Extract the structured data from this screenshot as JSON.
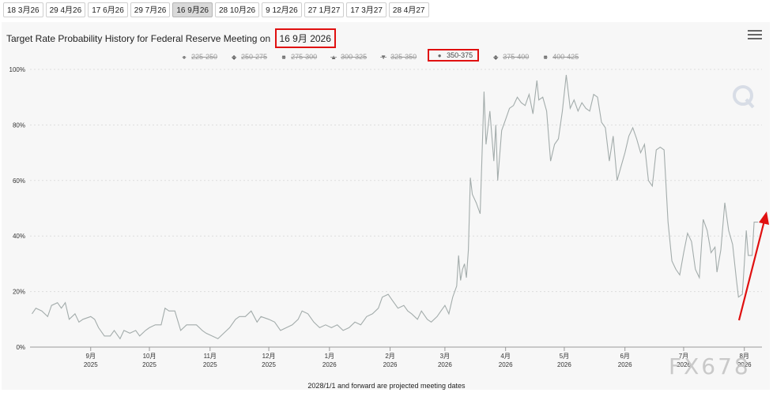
{
  "tabs": [
    {
      "label": "18 3月26",
      "active": false
    },
    {
      "label": "29 4月26",
      "active": false
    },
    {
      "label": "17 6月26",
      "active": false
    },
    {
      "label": "29 7月26",
      "active": false
    },
    {
      "label": "16 9月26",
      "active": true
    },
    {
      "label": "28 10月26",
      "active": false
    },
    {
      "label": "9 12月26",
      "active": false
    },
    {
      "label": "27 1月27",
      "active": false
    },
    {
      "label": "17 3月27",
      "active": false
    },
    {
      "label": "28 4月27",
      "active": false
    }
  ],
  "header": {
    "title_prefix": "Target Rate Probability History for Federal Reserve Meeting on",
    "title_date": "16 9月 2026",
    "menu_icon": "hamburger-menu-icon"
  },
  "footnote": "2028/1/1 and forward are projected meeting dates",
  "watermark": "FX678",
  "colors": {
    "series": "#a3acab",
    "annotation": "#e01010",
    "grid": "#dddddd",
    "panel": "#f7f7f7"
  },
  "chart_data": {
    "type": "line",
    "ylim": [
      0,
      100
    ],
    "y_ticks": [
      0,
      20,
      40,
      60,
      80,
      100
    ],
    "y_tick_labels": [
      "0%",
      "20%",
      "40%",
      "60%",
      "80%",
      "100%"
    ],
    "x_range": [
      "2025-08-01",
      "2026-08-10"
    ],
    "x_ticks": [
      {
        "date": "2025-09-01",
        "month": "9月",
        "year": "2025"
      },
      {
        "date": "2025-10-01",
        "month": "10月",
        "year": "2025"
      },
      {
        "date": "2025-11-01",
        "month": "11月",
        "year": "2025"
      },
      {
        "date": "2025-12-01",
        "month": "12月",
        "year": "2025"
      },
      {
        "date": "2026-01-01",
        "month": "1月",
        "year": "2026"
      },
      {
        "date": "2026-02-01",
        "month": "2月",
        "year": "2026"
      },
      {
        "date": "2026-03-01",
        "month": "3月",
        "year": "2026"
      },
      {
        "date": "2026-04-01",
        "month": "4月",
        "year": "2026"
      },
      {
        "date": "2026-05-01",
        "month": "5月",
        "year": "2026"
      },
      {
        "date": "2026-06-01",
        "month": "6月",
        "year": "2026"
      },
      {
        "date": "2026-07-01",
        "month": "7月",
        "year": "2026"
      },
      {
        "date": "2026-08-01",
        "month": "8月",
        "year": "2026"
      }
    ],
    "legend": [
      {
        "name": "225-250",
        "symbol": "●",
        "visible": false
      },
      {
        "name": "250-275",
        "symbol": "◆",
        "visible": false
      },
      {
        "name": "275-300",
        "symbol": "■",
        "visible": false
      },
      {
        "name": "300-325",
        "symbol": "▲",
        "visible": false
      },
      {
        "name": "325-350",
        "symbol": "▼",
        "visible": false
      },
      {
        "name": "350-375",
        "symbol": "●",
        "visible": true
      },
      {
        "name": "375-400",
        "symbol": "◆",
        "visible": false
      },
      {
        "name": "400-425",
        "symbol": "■",
        "visible": false
      }
    ],
    "series": [
      {
        "name": "350-375",
        "points": [
          [
            "2025-08-02",
            12
          ],
          [
            "2025-08-04",
            14
          ],
          [
            "2025-08-07",
            13
          ],
          [
            "2025-08-10",
            11
          ],
          [
            "2025-08-12",
            15
          ],
          [
            "2025-08-15",
            16
          ],
          [
            "2025-08-17",
            14
          ],
          [
            "2025-08-19",
            16
          ],
          [
            "2025-08-21",
            10
          ],
          [
            "2025-08-24",
            12
          ],
          [
            "2025-08-26",
            9
          ],
          [
            "2025-08-28",
            10
          ],
          [
            "2025-09-01",
            11
          ],
          [
            "2025-09-03",
            10
          ],
          [
            "2025-09-05",
            7
          ],
          [
            "2025-09-08",
            4
          ],
          [
            "2025-09-11",
            4
          ],
          [
            "2025-09-13",
            6
          ],
          [
            "2025-09-16",
            3
          ],
          [
            "2025-09-18",
            6
          ],
          [
            "2025-09-21",
            5
          ],
          [
            "2025-09-24",
            6
          ],
          [
            "2025-09-26",
            4
          ],
          [
            "2025-09-29",
            6
          ],
          [
            "2025-10-01",
            7
          ],
          [
            "2025-10-04",
            8
          ],
          [
            "2025-10-07",
            8
          ],
          [
            "2025-10-09",
            14
          ],
          [
            "2025-10-11",
            13
          ],
          [
            "2025-10-14",
            13
          ],
          [
            "2025-10-17",
            6
          ],
          [
            "2025-10-20",
            8
          ],
          [
            "2025-10-22",
            8
          ],
          [
            "2025-10-25",
            8
          ],
          [
            "2025-10-28",
            6
          ],
          [
            "2025-10-30",
            5
          ],
          [
            "2025-11-02",
            4
          ],
          [
            "2025-11-05",
            3
          ],
          [
            "2025-11-08",
            5
          ],
          [
            "2025-11-11",
            7
          ],
          [
            "2025-11-14",
            10
          ],
          [
            "2025-11-16",
            11
          ],
          [
            "2025-11-19",
            11
          ],
          [
            "2025-11-22",
            13
          ],
          [
            "2025-11-25",
            9
          ],
          [
            "2025-11-27",
            11
          ],
          [
            "2025-12-01",
            10
          ],
          [
            "2025-12-04",
            9
          ],
          [
            "2025-12-07",
            6
          ],
          [
            "2025-12-10",
            7
          ],
          [
            "2025-12-13",
            8
          ],
          [
            "2025-12-16",
            10
          ],
          [
            "2025-12-18",
            13
          ],
          [
            "2025-12-21",
            12
          ],
          [
            "2025-12-24",
            9
          ],
          [
            "2025-12-27",
            7
          ],
          [
            "2025-12-30",
            8
          ],
          [
            "2026-01-02",
            7
          ],
          [
            "2026-01-05",
            8
          ],
          [
            "2026-01-08",
            6
          ],
          [
            "2026-01-11",
            7
          ],
          [
            "2026-01-14",
            9
          ],
          [
            "2026-01-17",
            8
          ],
          [
            "2026-01-20",
            11
          ],
          [
            "2026-01-23",
            12
          ],
          [
            "2026-01-26",
            14
          ],
          [
            "2026-01-28",
            18
          ],
          [
            "2026-01-31",
            19
          ],
          [
            "2026-02-02",
            17
          ],
          [
            "2026-02-05",
            14
          ],
          [
            "2026-02-08",
            15
          ],
          [
            "2026-02-10",
            13
          ],
          [
            "2026-02-12",
            12
          ],
          [
            "2026-02-15",
            10
          ],
          [
            "2026-02-17",
            13
          ],
          [
            "2026-02-20",
            10
          ],
          [
            "2026-02-22",
            9
          ],
          [
            "2026-02-25",
            11
          ],
          [
            "2026-02-27",
            13
          ],
          [
            "2026-03-01",
            15
          ],
          [
            "2026-03-03",
            12
          ],
          [
            "2026-03-05",
            18
          ],
          [
            "2026-03-07",
            22
          ],
          [
            "2026-03-08",
            33
          ],
          [
            "2026-03-09",
            24
          ],
          [
            "2026-03-10",
            28
          ],
          [
            "2026-03-11",
            30
          ],
          [
            "2026-03-12",
            25
          ],
          [
            "2026-03-13",
            35
          ],
          [
            "2026-03-14",
            61
          ],
          [
            "2026-03-15",
            55
          ],
          [
            "2026-03-17",
            52
          ],
          [
            "2026-03-19",
            48
          ],
          [
            "2026-03-21",
            92
          ],
          [
            "2026-03-22",
            73
          ],
          [
            "2026-03-24",
            85
          ],
          [
            "2026-03-26",
            67
          ],
          [
            "2026-03-27",
            80
          ],
          [
            "2026-03-28",
            60
          ],
          [
            "2026-03-30",
            78
          ],
          [
            "2026-04-01",
            82
          ],
          [
            "2026-04-03",
            86
          ],
          [
            "2026-04-05",
            87
          ],
          [
            "2026-04-07",
            90
          ],
          [
            "2026-04-09",
            88
          ],
          [
            "2026-04-11",
            87
          ],
          [
            "2026-04-13",
            91
          ],
          [
            "2026-04-15",
            84
          ],
          [
            "2026-04-17",
            96
          ],
          [
            "2026-04-18",
            89
          ],
          [
            "2026-04-20",
            90
          ],
          [
            "2026-04-22",
            85
          ],
          [
            "2026-04-24",
            67
          ],
          [
            "2026-04-26",
            73
          ],
          [
            "2026-04-28",
            75
          ],
          [
            "2026-04-30",
            85
          ],
          [
            "2026-05-02",
            98
          ],
          [
            "2026-05-04",
            86
          ],
          [
            "2026-05-06",
            89
          ],
          [
            "2026-05-08",
            85
          ],
          [
            "2026-05-10",
            88
          ],
          [
            "2026-05-12",
            86
          ],
          [
            "2026-05-14",
            85
          ],
          [
            "2026-05-16",
            91
          ],
          [
            "2026-05-18",
            90
          ],
          [
            "2026-05-20",
            81
          ],
          [
            "2026-05-22",
            79
          ],
          [
            "2026-05-24",
            67
          ],
          [
            "2026-05-26",
            76
          ],
          [
            "2026-05-28",
            60
          ],
          [
            "2026-05-30",
            65
          ],
          [
            "2026-06-01",
            70
          ],
          [
            "2026-06-03",
            76
          ],
          [
            "2026-06-05",
            79
          ],
          [
            "2026-06-07",
            75
          ],
          [
            "2026-06-09",
            70
          ],
          [
            "2026-06-11",
            73
          ],
          [
            "2026-06-13",
            60
          ],
          [
            "2026-06-15",
            58
          ],
          [
            "2026-06-17",
            71
          ],
          [
            "2026-06-19",
            72
          ],
          [
            "2026-06-21",
            71
          ],
          [
            "2026-06-23",
            45
          ],
          [
            "2026-06-25",
            31
          ],
          [
            "2026-06-27",
            28
          ],
          [
            "2026-06-29",
            26
          ],
          [
            "2026-07-01",
            34
          ],
          [
            "2026-07-03",
            41
          ],
          [
            "2026-07-05",
            38
          ],
          [
            "2026-07-07",
            28
          ],
          [
            "2026-07-09",
            25
          ],
          [
            "2026-07-11",
            46
          ],
          [
            "2026-07-13",
            42
          ],
          [
            "2026-07-15",
            34
          ],
          [
            "2026-07-17",
            36
          ],
          [
            "2026-07-18",
            27
          ],
          [
            "2026-07-20",
            35
          ],
          [
            "2026-07-22",
            52
          ],
          [
            "2026-07-24",
            42
          ],
          [
            "2026-07-26",
            37
          ],
          [
            "2026-07-28",
            24
          ],
          [
            "2026-07-29",
            18
          ],
          [
            "2026-07-31",
            19
          ],
          [
            "2026-08-01",
            30
          ],
          [
            "2026-08-02",
            42
          ],
          [
            "2026-08-03",
            33
          ],
          [
            "2026-08-05",
            33
          ],
          [
            "2026-08-06",
            45
          ],
          [
            "2026-08-08",
            45
          ]
        ]
      }
    ],
    "annotations": {
      "title_highlight": "red box around meeting date",
      "legend_highlight": "red box around 350-375",
      "arrow": "red upward arrow at right edge"
    }
  }
}
